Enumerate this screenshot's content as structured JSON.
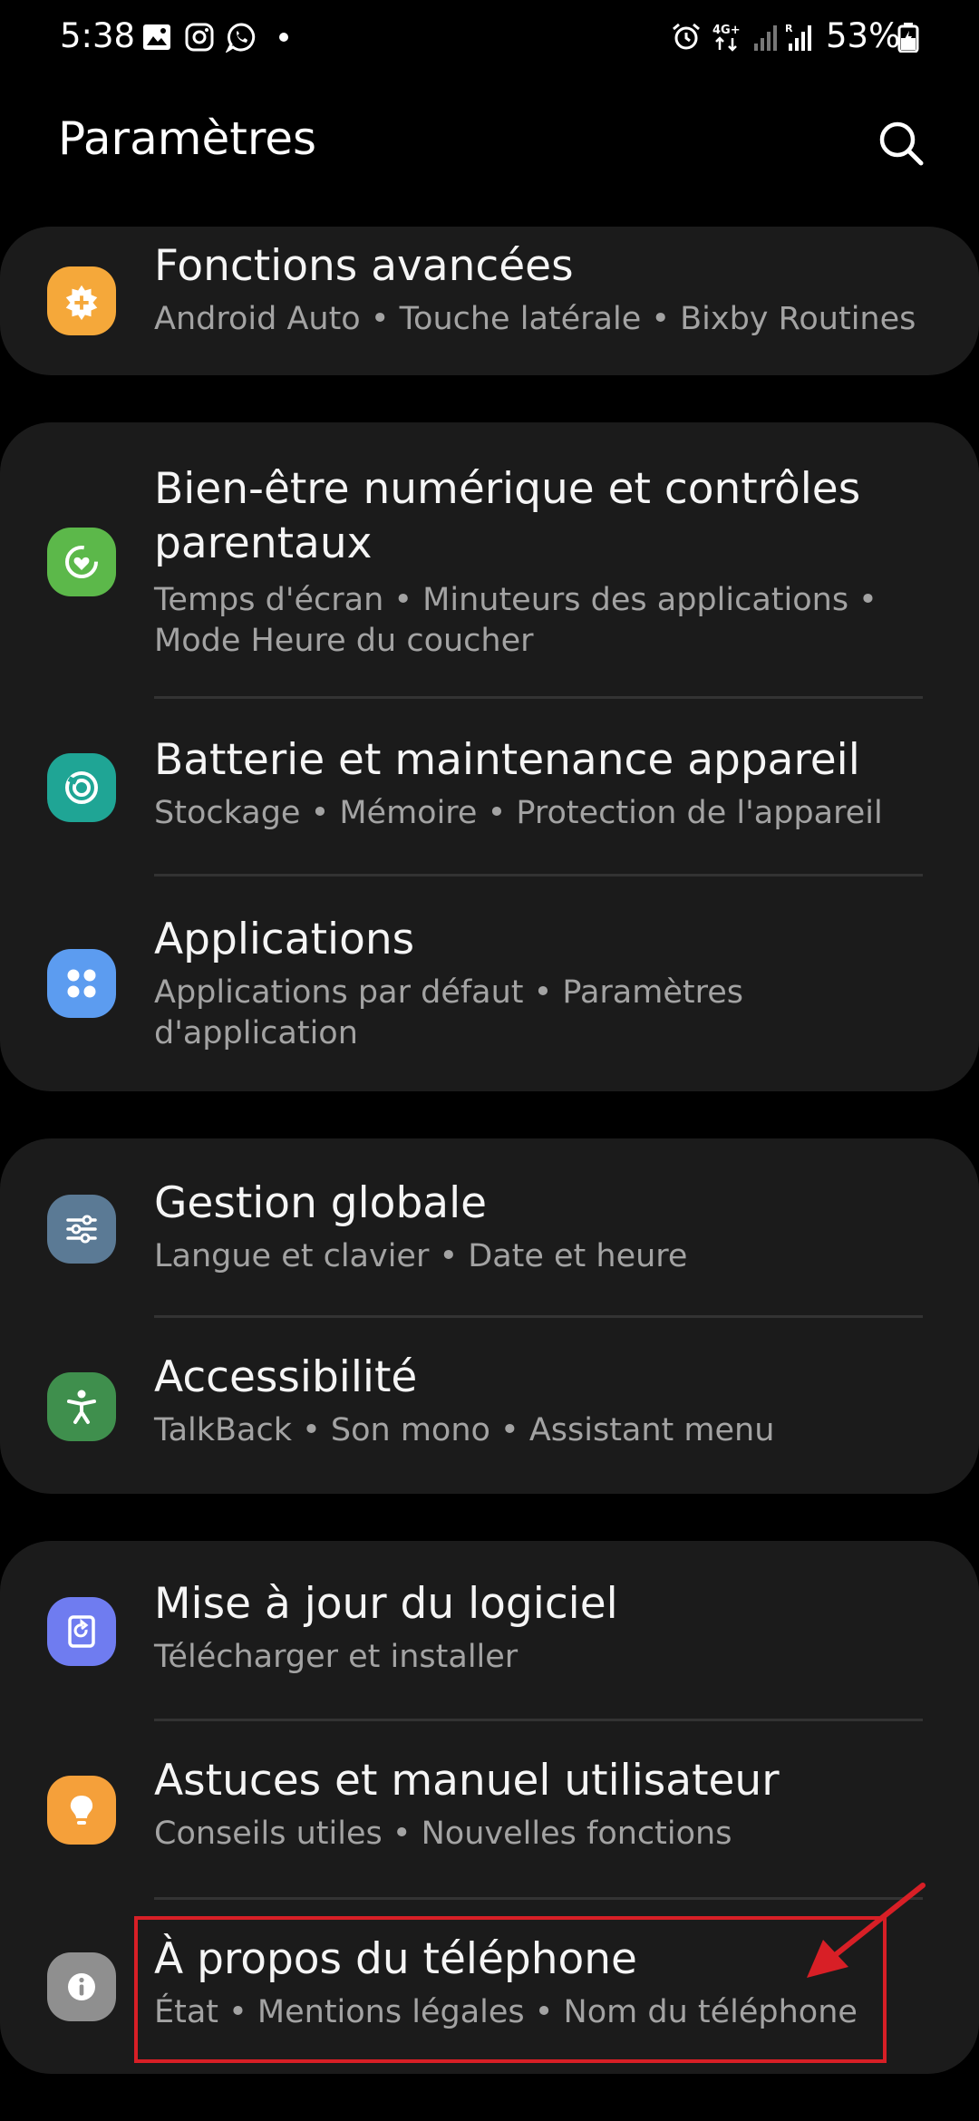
{
  "status_bar": {
    "time": "5:38",
    "network": "4G+",
    "battery": "53%",
    "icons": [
      "gallery-icon",
      "instagram-icon",
      "whatsapp-icon",
      "dot-icon",
      "alarm-icon",
      "network-4g-icon",
      "signal-icon",
      "signal-roaming-icon",
      "battery-icon"
    ]
  },
  "header": {
    "title": "Paramètres",
    "search_icon": "search-icon"
  },
  "colors": {
    "background": "#000000",
    "card": "#1b1b1b",
    "highlight": "#d81f26"
  },
  "cards": [
    {
      "items": [
        {
          "title": "Fonctions avancées",
          "subtitle": "Android Auto  •  Touche latérale  •  Bixby Routines",
          "icon": "advanced-features-icon",
          "icon_color": "#f5a83a"
        }
      ]
    },
    {
      "items": [
        {
          "title": "Bien-être numérique et contrôles parentaux",
          "subtitle": "Temps d'écran  •  Minuteurs des applications  •  Mode Heure du coucher",
          "icon": "digital-wellbeing-icon",
          "icon_color": "#5cb84a"
        },
        {
          "title": "Batterie et maintenance appareil",
          "subtitle": "Stockage  •  Mémoire  •  Protection de l'appareil",
          "icon": "device-care-icon",
          "icon_color": "#1fa595"
        },
        {
          "title": "Applications",
          "subtitle": "Applications par défaut  •  Paramètres d'application",
          "icon": "apps-icon",
          "icon_color": "#5c9cf0"
        }
      ]
    },
    {
      "items": [
        {
          "title": "Gestion globale",
          "subtitle": "Langue et clavier  •  Date et heure",
          "icon": "general-management-icon",
          "icon_color": "#5b7a95"
        },
        {
          "title": "Accessibilité",
          "subtitle": "TalkBack  •  Son mono  •  Assistant menu",
          "icon": "accessibility-icon",
          "icon_color": "#3f8f4d"
        }
      ]
    },
    {
      "items": [
        {
          "title": "Mise à jour du logiciel",
          "subtitle": "Télécharger et installer",
          "icon": "software-update-icon",
          "icon_color": "#6f7cf0"
        },
        {
          "title": "Astuces et manuel utilisateur",
          "subtitle": "Conseils utiles  •  Nouvelles fonctions",
          "icon": "tips-icon",
          "icon_color": "#f5a03a"
        },
        {
          "title": "À propos du téléphone",
          "subtitle": "État  •  Mentions légales  •  Nom du téléphone",
          "icon": "about-phone-icon",
          "icon_color": "#8f8f8f"
        }
      ]
    }
  ]
}
